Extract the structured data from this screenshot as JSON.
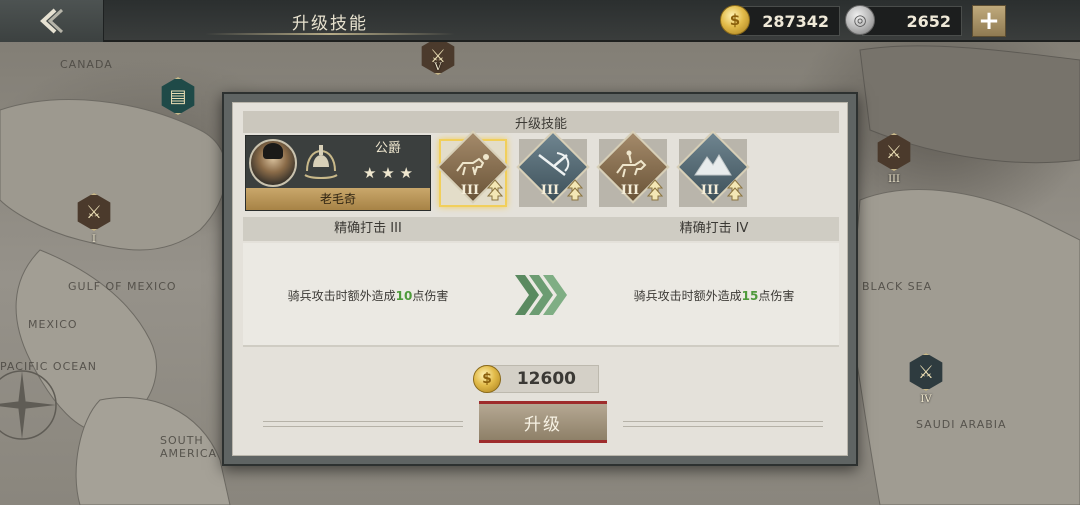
{
  "topbar": {
    "title": "升级技能",
    "gold_amount": "287342",
    "silver_amount": "2652",
    "plus_label": "+"
  },
  "map": {
    "labels": {
      "canada": "CANADA",
      "gulf": "GULF OF MEXICO",
      "mexico": "MEXICO",
      "pacific": "PACIFIC OCEAN",
      "south_america": "SOUTH AMERICA",
      "black_sea": "BLACK SEA",
      "saudi": "SAUDI ARABIA"
    },
    "markers": [
      {
        "rank": "I"
      },
      {
        "rank": "V"
      },
      {
        "rank": "III"
      },
      {
        "rank": "IV"
      }
    ]
  },
  "modal": {
    "header": "升级技能",
    "general": {
      "rank": "公爵",
      "stars": "★ ★ ★",
      "name": "老毛奇"
    },
    "skills": [
      {
        "level": "III",
        "icon": "cavalry-icon",
        "selected": true
      },
      {
        "level": "III",
        "icon": "crossed-swords-icon",
        "selected": false
      },
      {
        "level": "III",
        "icon": "horse-archer-icon",
        "selected": false
      },
      {
        "level": "III",
        "icon": "mountain-icon",
        "selected": false
      }
    ],
    "current": {
      "title": "精确打击 III",
      "desc_pre": "骑兵攻击时额外造成",
      "desc_num": "10",
      "desc_post": "点伤害"
    },
    "next": {
      "title": "精确打击 IV",
      "desc_pre": "骑兵攻击时额外造成",
      "desc_num": "15",
      "desc_post": "点伤害"
    },
    "cost": "12600",
    "upgrade_label": "升级"
  },
  "colors": {
    "accent_gold": "#f1cf5b",
    "highlight_green": "#4e9a3b",
    "button_border_red": "#9e2c2c"
  }
}
